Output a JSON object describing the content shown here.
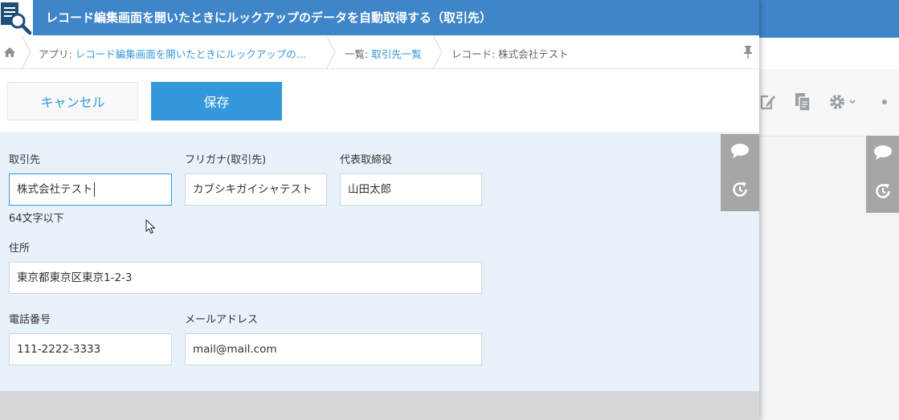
{
  "dialog": {
    "title": "レコード編集画面を開いたときにルックアップのデータを自動取得する（取引先）"
  },
  "breadcrumb": {
    "app_prefix": "アプリ: ",
    "app_name": "レコード編集画面を開いたときにルックアップの…",
    "list_prefix": "一覧: ",
    "list_name": "取引先一覧",
    "record_label": "レコード: 株式会社テスト"
  },
  "toolbar": {
    "cancel_label": "キャンセル",
    "save_label": "保存"
  },
  "form": {
    "company": {
      "label": "取引先",
      "value": "株式会社テスト",
      "hint": "64文字以下"
    },
    "furigana": {
      "label": "フリガナ(取引先)",
      "value": "カブシキガイシャテスト"
    },
    "representative": {
      "label": "代表取締役",
      "value": "山田太郎"
    },
    "address": {
      "label": "住所",
      "value": "東京都東京区東京1-2-3"
    },
    "phone": {
      "label": "電話番号",
      "value": "111-2222-3333"
    },
    "email": {
      "label": "メールアドレス",
      "value": "mail@mail.com"
    }
  },
  "icons": {
    "app": "magnifier-document-icon",
    "home": "home-icon",
    "pin": "pin-icon",
    "comment": "comment-icon",
    "history": "history-icon",
    "edit": "edit-icon",
    "duplicate": "duplicate-icon",
    "settings": "gear-icon"
  },
  "colors": {
    "header": "#3f85c9",
    "accent": "#3498db",
    "form_bg": "#e8f2fb",
    "side_strip": "#a6a6a6"
  }
}
